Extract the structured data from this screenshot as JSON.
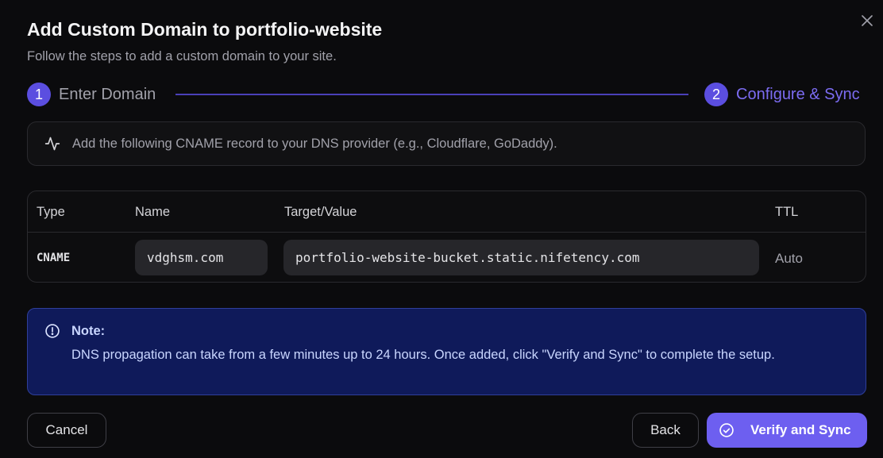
{
  "dialog": {
    "title": "Add Custom Domain to portfolio-website",
    "subtitle": "Follow the steps to add a custom domain to your site."
  },
  "steps": [
    {
      "number": "1",
      "label": "Enter Domain"
    },
    {
      "number": "2",
      "label": "Configure & Sync"
    }
  ],
  "info": {
    "icon": "activity-icon",
    "text": "Add the following CNAME record to your DNS provider (e.g., Cloudflare, GoDaddy)."
  },
  "table": {
    "headers": [
      "Type",
      "Name",
      "Target/Value",
      "TTL"
    ],
    "row": {
      "type": "CNAME",
      "name": "vdghsm.com",
      "target": "portfolio-website-bucket.static.nifetency.com",
      "ttl": "Auto"
    }
  },
  "note": {
    "icon": "info-circle-icon",
    "heading": "Note:",
    "body": "DNS propagation can take from a few minutes up to 24 hours. Once added, click \"Verify and Sync\" to complete the setup."
  },
  "buttons": {
    "cancel": "Cancel",
    "back": "Back",
    "verify": "Verify and Sync"
  },
  "colors": {
    "accent": "#6d5ff0",
    "note_bg": "#0f1a5a",
    "background": "#0b0b0d"
  }
}
